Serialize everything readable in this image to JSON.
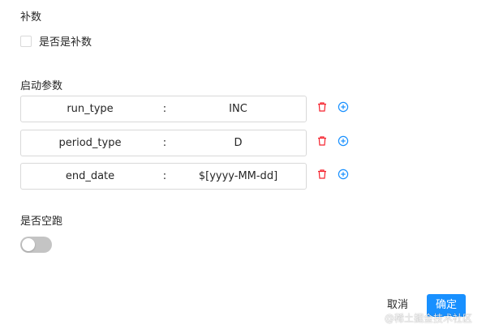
{
  "backfill_section": {
    "title": "补数",
    "checkbox_label": "是否是补数",
    "checked": false
  },
  "startup_params": {
    "title": "启动参数",
    "separator": ":",
    "rows": [
      {
        "key": "run_type",
        "value": "INC"
      },
      {
        "key": "period_type",
        "value": "D"
      },
      {
        "key": "end_date",
        "value": "$[yyyy-MM-dd]"
      }
    ],
    "icons": {
      "delete": "trash-icon",
      "add": "plus-circle-icon"
    },
    "colors": {
      "delete": "#f5222d",
      "add": "#1890ff"
    }
  },
  "dry_run": {
    "title": "是否空跑",
    "enabled": false
  },
  "footer": {
    "cancel_label": "取消",
    "ok_label": "确定"
  },
  "watermark": "@稀土掘金技术社区",
  "colors": {
    "primary": "#1890ff",
    "border": "#d9d9d9",
    "toggle_off": "#c4c4c4"
  }
}
